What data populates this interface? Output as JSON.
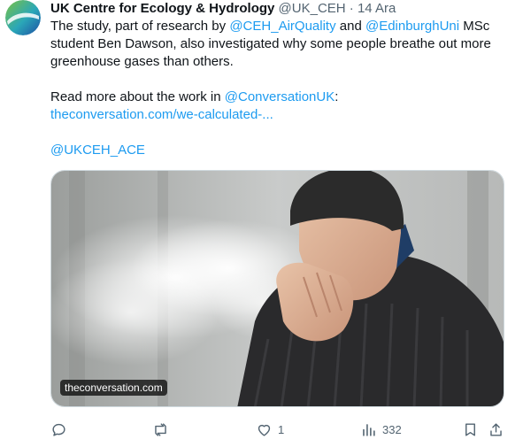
{
  "author": {
    "name": "UK Centre for Ecology & Hydrology",
    "handle": "@UK_CEH",
    "separator": "·",
    "date": "14 Ara"
  },
  "tweet": {
    "p1_t1": "The study, part of research by ",
    "p1_l1": "@CEH_AirQuality",
    "p1_t2": " and ",
    "p1_l2": "@EdinburghUni",
    "p1_t3": " MSc student Ben Dawson, also investigated why some people breathe out more greenhouse gases than others.",
    "p2_t1": "Read more about the work in ",
    "p2_l1": "@ConversationUK",
    "p2_t2": ":",
    "link_url": "theconversation.com/we-calculated-...",
    "mention": "@UKCEH_ACE"
  },
  "media": {
    "caption": "theconversation.com"
  },
  "actions": {
    "reply_icon": "reply-icon",
    "retweet_icon": "retweet-icon",
    "like_icon": "heart-icon",
    "like_count": "1",
    "views_icon": "analytics-icon",
    "views_count": "332",
    "bookmark_icon": "bookmark-icon",
    "share_icon": "share-icon"
  },
  "colors": {
    "link": "#1d9bf0",
    "muted": "#536471",
    "text": "#0f1419"
  }
}
